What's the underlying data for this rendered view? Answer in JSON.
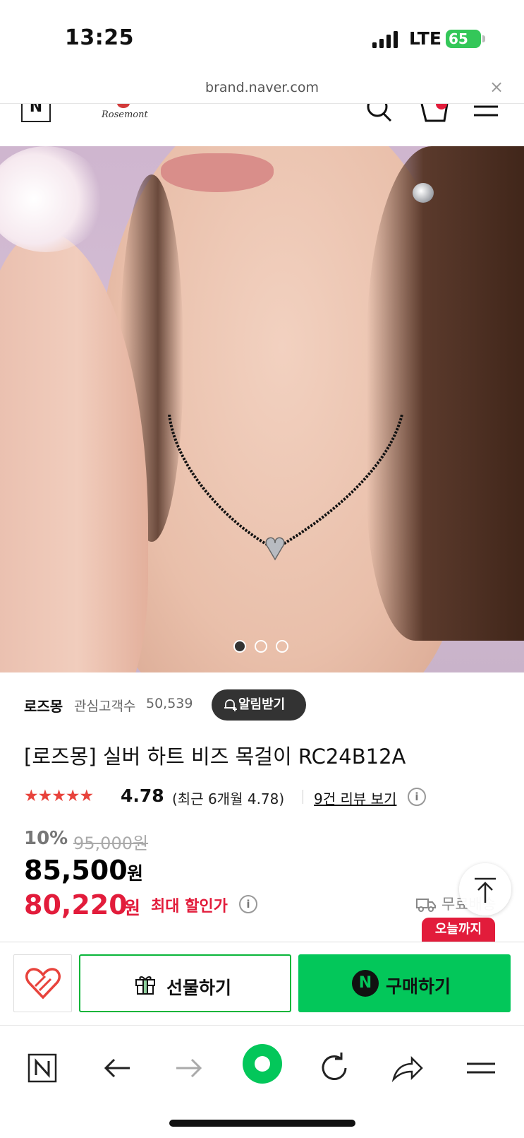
{
  "status_bar": {
    "time": "13:25",
    "network": "LTE",
    "battery": "65"
  },
  "browser": {
    "url": "brand.naver.com",
    "close_glyph": "×"
  },
  "site_header": {
    "naver_logo": "N",
    "brand_logo_text": "Rosemont"
  },
  "gallery": {
    "dot_count": 3,
    "active_index": 0
  },
  "product": {
    "brand": "로즈몽",
    "fans_label": "관심고객수",
    "fans_count": "50,539",
    "alarm_button": "알림받기",
    "title": "[로즈몽] 실버 하트 비즈 목걸이 RC24B12A",
    "stars": "★★★★★",
    "rating": "4.78",
    "recent_rating": "(최근 6개월 4.78)",
    "review_link": "9건 리뷰 보기",
    "discount_pct": "10%",
    "original_price": "95,000원",
    "price": "85,500",
    "max_discount_price": "80,220",
    "currency": "원",
    "max_discount_label": "최대 할인가",
    "shipping": "무료배송",
    "today_badge": "오늘까지"
  },
  "buy_bar": {
    "gift_label": "선물하기",
    "buy_label": "구매하기",
    "buy_logo": "N"
  },
  "colors": {
    "naver_green": "#03c75a",
    "sale_red": "#e21c3b",
    "star_red": "#e8433c"
  }
}
